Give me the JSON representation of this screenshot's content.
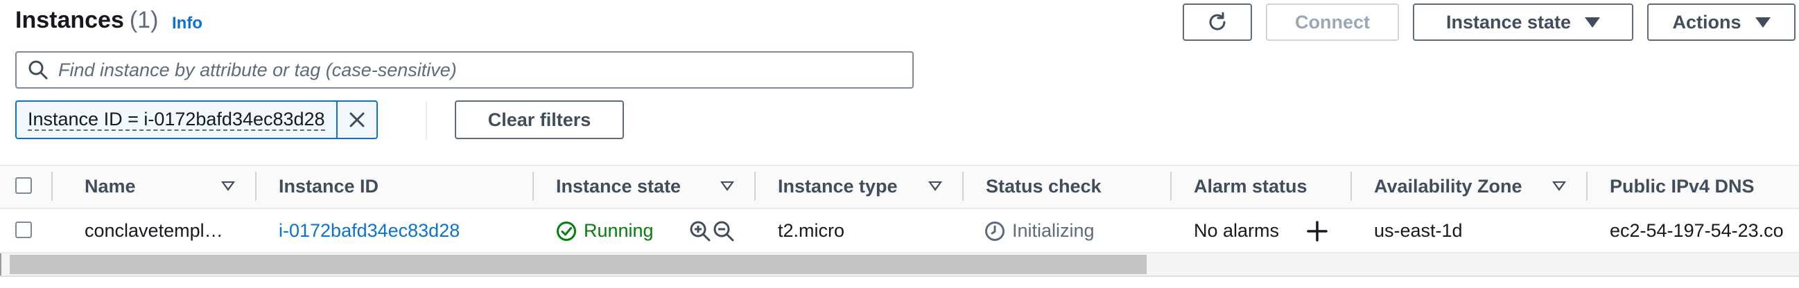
{
  "header": {
    "title": "Instances",
    "count": "(1)",
    "info_label": "Info"
  },
  "actions": {
    "refresh_icon": "refresh-icon",
    "connect_label": "Connect",
    "instance_state_label": "Instance state",
    "actions_label": "Actions"
  },
  "search": {
    "placeholder": "Find instance by attribute or tag (case-sensitive)"
  },
  "filter": {
    "token_label": "Instance ID = i-0172bafd34ec83d28",
    "clear_label": "Clear filters"
  },
  "table": {
    "columns": [
      {
        "label": "Name",
        "sortable": true
      },
      {
        "label": "Instance ID",
        "sortable": false
      },
      {
        "label": "Instance state",
        "sortable": true
      },
      {
        "label": "Instance type",
        "sortable": true
      },
      {
        "label": "Status check",
        "sortable": false
      },
      {
        "label": "Alarm status",
        "sortable": false
      },
      {
        "label": "Availability Zone",
        "sortable": true
      },
      {
        "label": "Public IPv4 DNS",
        "sortable": false
      }
    ],
    "rows": [
      {
        "name": "conclavetempl…",
        "instance_id": "i-0172bafd34ec83d28",
        "instance_state": "Running",
        "instance_type": "t2.micro",
        "status_check": "Initializing",
        "alarm_status": "No alarms",
        "availability_zone": "us-east-1d",
        "public_dns": "ec2-54-197-54-23.co"
      }
    ]
  },
  "colors": {
    "link": "#0972d3",
    "running": "#037f0c",
    "text": "#16191f",
    "muted": "#5f6b7a"
  }
}
